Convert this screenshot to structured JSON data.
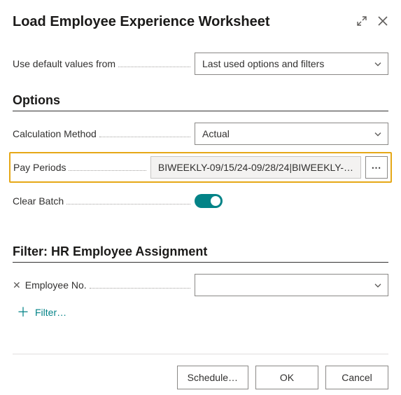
{
  "header": {
    "title": "Load Employee Experience Worksheet"
  },
  "defaults": {
    "label": "Use default values from",
    "value": "Last used options and filters"
  },
  "options": {
    "heading": "Options",
    "calc_method": {
      "label": "Calculation Method",
      "value": "Actual"
    },
    "pay_periods": {
      "label": "Pay Periods",
      "value": "BIWEEKLY-09/15/24-09/28/24|BIWEEKLY-…"
    },
    "clear_batch": {
      "label": "Clear Batch",
      "on": true
    }
  },
  "filter": {
    "heading": "Filter: HR Employee Assignment",
    "employee_no": {
      "label": "Employee No.",
      "value": ""
    },
    "add_label": "Filter…"
  },
  "footer": {
    "schedule": "Schedule…",
    "ok": "OK",
    "cancel": "Cancel"
  }
}
